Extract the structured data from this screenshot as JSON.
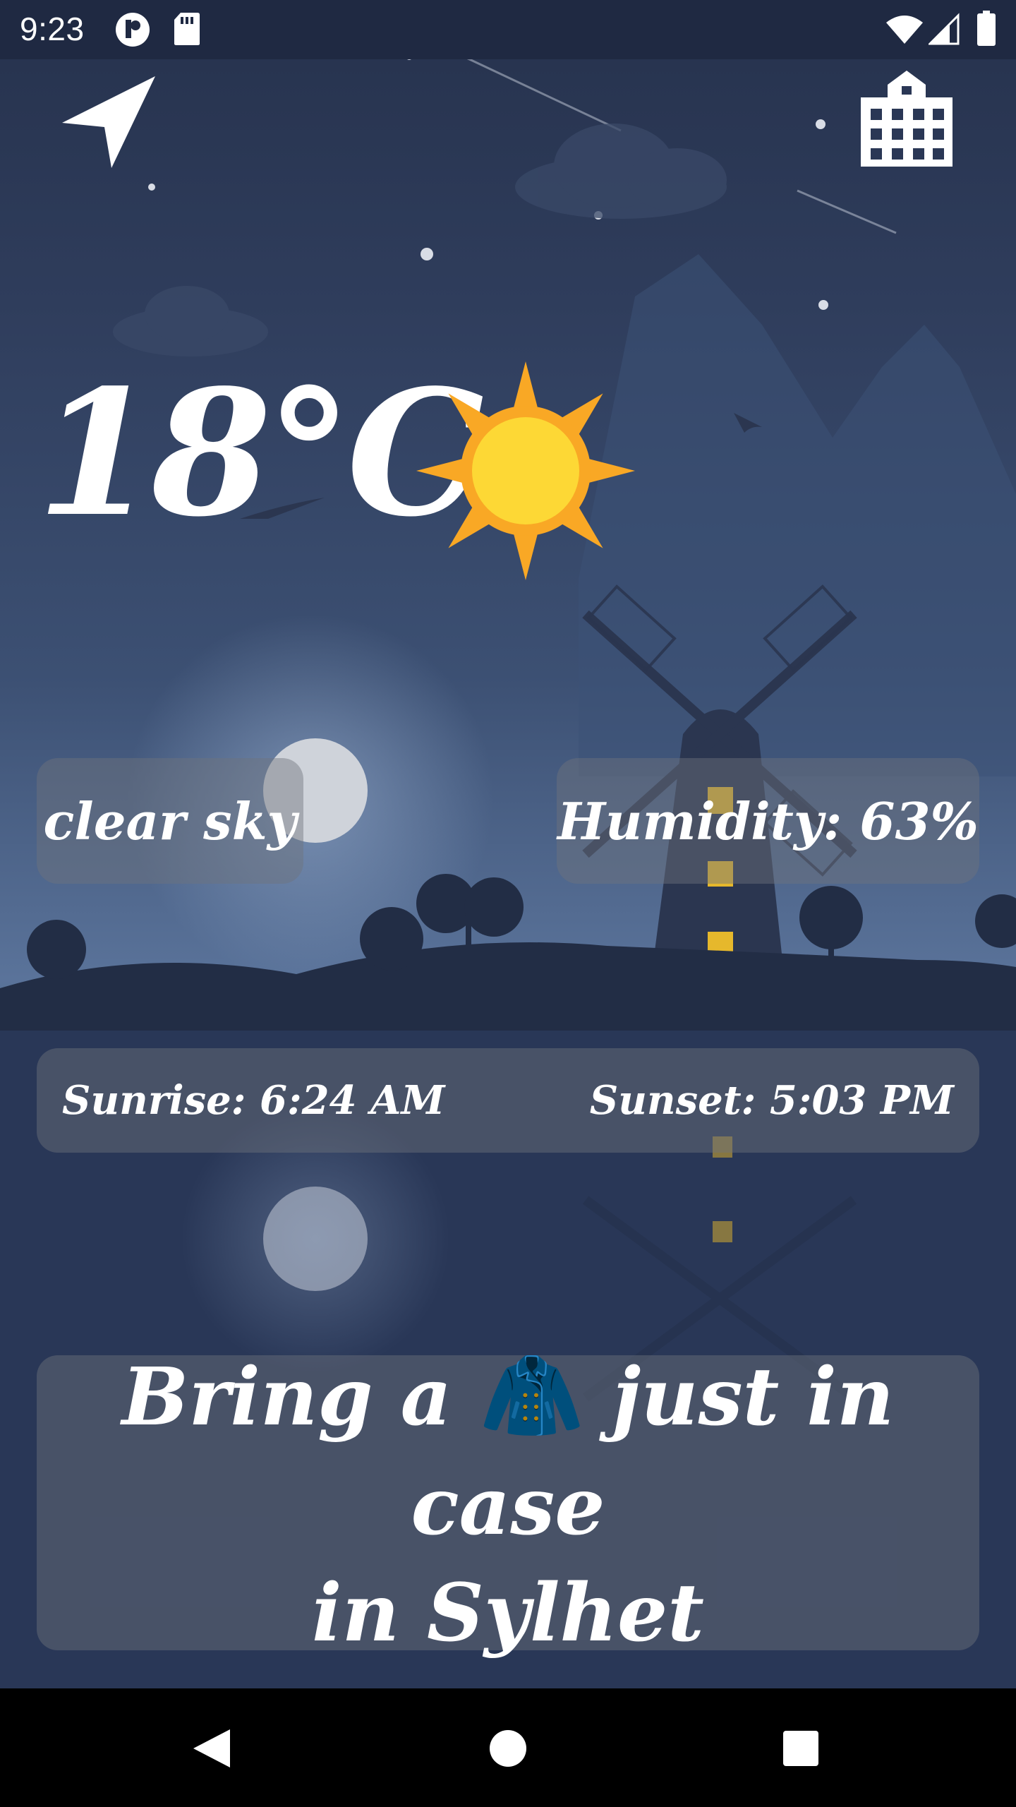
{
  "status_bar": {
    "time": "9:23",
    "icons": [
      "app-notification-icon",
      "sd-card-icon",
      "wifi-icon",
      "cellular-signal-icon",
      "battery-icon"
    ]
  },
  "toolbar": {
    "location_icon": "navigation-arrow-icon",
    "city_icon": "city-building-icon"
  },
  "weather": {
    "temperature": "18°C",
    "condition_icon": "sun-icon",
    "description": "clear sky",
    "humidity": "Humidity: 63%",
    "sunrise": "Sunrise: 6:24 AM",
    "sunset": "Sunset: 5:03 PM"
  },
  "tip": {
    "before": "Bring a",
    "emoji": "🧥",
    "after": "just in case",
    "line2": "in Sylhet"
  },
  "nav_bar": {
    "icons": [
      "back-icon",
      "home-icon",
      "recents-icon"
    ]
  },
  "colors": {
    "sun_outer": "#f9a825",
    "sun_inner": "#fdd835",
    "sky_dark": "#26324d",
    "card_glass": "#6e737d"
  }
}
